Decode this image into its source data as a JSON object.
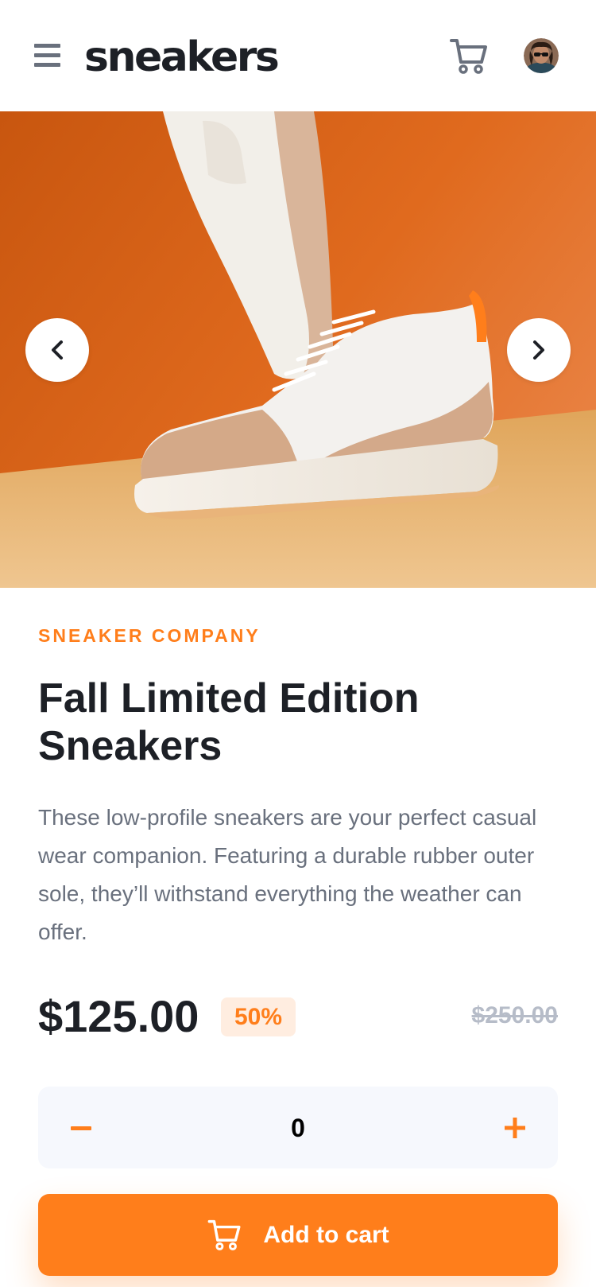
{
  "header": {
    "logo": "sneakers",
    "menu_icon": "hamburger-menu-icon",
    "cart_icon": "cart-icon",
    "avatar_icon": "user-avatar"
  },
  "gallery": {
    "prev_icon": "chevron-left-icon",
    "next_icon": "chevron-right-icon"
  },
  "product": {
    "company": "SNEAKER COMPANY",
    "title_line1": "Fall Limited Edition",
    "title_line2": "Sneakers",
    "description": "These low-profile sneakers are your perfect casual wear companion. Featuring a durable rubber outer sole, they’ll withstand everything the weather can offer.",
    "price": "$125.00",
    "discount": "50%",
    "original_price": "$250.00"
  },
  "quantity": {
    "value": "0",
    "minus_icon": "minus-icon",
    "plus_icon": "plus-icon"
  },
  "add_to_cart": {
    "label": "Add to cart",
    "icon": "cart-icon"
  },
  "colors": {
    "accent": "#ff7e1b",
    "accent_pale": "#ffede0",
    "dark": "#1d2026",
    "grey": "#69707d",
    "light_grey": "#b6bcc8",
    "qty_bg": "#f6f8fd"
  }
}
